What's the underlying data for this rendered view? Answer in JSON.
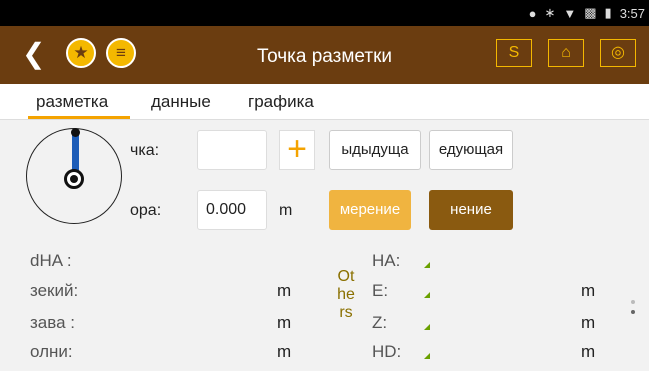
{
  "status": {
    "time": "3:57"
  },
  "appbar": {
    "title": "Точка разметки",
    "s_button": "S"
  },
  "tabs": [
    {
      "label": "разметка"
    },
    {
      "label": "данные"
    },
    {
      "label": "графика"
    }
  ],
  "form": {
    "point_label": "чка:",
    "point_value": "",
    "prev_button": "ыдыдуща",
    "next_button": "едующая",
    "height_label": "ора:",
    "height_value": "0.000",
    "height_unit": "m",
    "measure_button": "мерение",
    "save_button": "нение"
  },
  "data_left": [
    {
      "label": "dHA  :",
      "unit": ""
    },
    {
      "label": "зекий:",
      "unit": "m"
    },
    {
      "label": "зава :",
      "unit": "m"
    },
    {
      "label": "олни:",
      "unit": "m"
    }
  ],
  "others_label": "Ot he rs",
  "data_right": [
    {
      "label": "HA:",
      "unit": ""
    },
    {
      "label": "E:",
      "unit": "m"
    },
    {
      "label": "Z:",
      "unit": "m"
    },
    {
      "label": "HD:",
      "unit": "m"
    }
  ],
  "colors": {
    "appbar": "#6b3d10",
    "accent": "#f4b800",
    "measure_button": "#f0b440",
    "save_button": "#8a5a10"
  },
  "icons": {
    "back": "back-arrow-icon",
    "favorite": "star-icon",
    "database": "database-icon",
    "home": "home-icon",
    "target": "target-icon"
  }
}
